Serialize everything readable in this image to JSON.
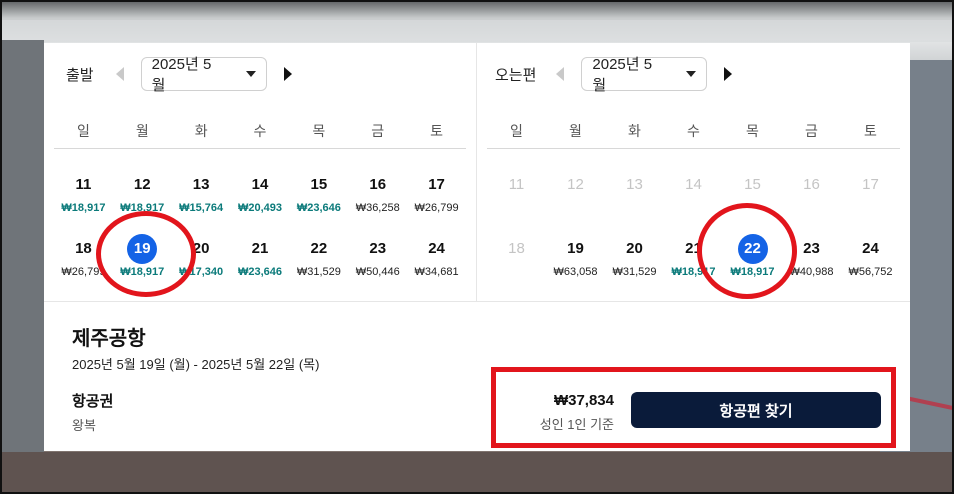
{
  "depart": {
    "title": "출발",
    "month": "2025년 5월",
    "weekdays": [
      "일",
      "월",
      "화",
      "수",
      "목",
      "금",
      "토"
    ],
    "week1": [
      {
        "day": "11",
        "price": "₩18,917"
      },
      {
        "day": "12",
        "price": "₩18,917"
      },
      {
        "day": "13",
        "price": "₩15,764"
      },
      {
        "day": "14",
        "price": "₩20,493"
      },
      {
        "day": "15",
        "price": "₩23,646"
      },
      {
        "day": "16",
        "price": "₩36,258"
      },
      {
        "day": "17",
        "price": "₩26,799"
      }
    ],
    "week2": [
      {
        "day": "18",
        "price": "₩26,799"
      },
      {
        "day": "19",
        "price": "₩18,917"
      },
      {
        "day": "20",
        "price": "₩17,340"
      },
      {
        "day": "21",
        "price": "₩23,646"
      },
      {
        "day": "22",
        "price": "₩31,529"
      },
      {
        "day": "23",
        "price": "₩50,446"
      },
      {
        "day": "24",
        "price": "₩34,681"
      }
    ]
  },
  "return": {
    "title": "오는편",
    "month": "2025년 5월",
    "weekdays": [
      "일",
      "월",
      "화",
      "수",
      "목",
      "금",
      "토"
    ],
    "week1": [
      {
        "day": "11"
      },
      {
        "day": "12"
      },
      {
        "day": "13"
      },
      {
        "day": "14"
      },
      {
        "day": "15"
      },
      {
        "day": "16"
      },
      {
        "day": "17"
      }
    ],
    "week2": [
      {
        "day": "18",
        "price": ""
      },
      {
        "day": "19",
        "price": "₩63,058"
      },
      {
        "day": "20",
        "price": "₩31,529"
      },
      {
        "day": "21",
        "price": "₩18,917"
      },
      {
        "day": "22",
        "price": "₩18,917"
      },
      {
        "day": "23",
        "price": "₩40,988"
      },
      {
        "day": "24",
        "price": "₩56,752"
      }
    ]
  },
  "summary": {
    "destination": "제주공항",
    "dates": "2025년 5월 19일 (월) - 2025년 5월 22일 (목)",
    "ticket_label": "항공권",
    "trip_type": "왕복",
    "total_price": "₩37,834",
    "price_basis": "성인 1인 기준",
    "search_button": "항공편 찾기"
  },
  "colors": {
    "selected": "#1463e6",
    "cheap_price": "#0b7a7a",
    "annotation": "#e2151c",
    "button": "#0a1b3a"
  }
}
